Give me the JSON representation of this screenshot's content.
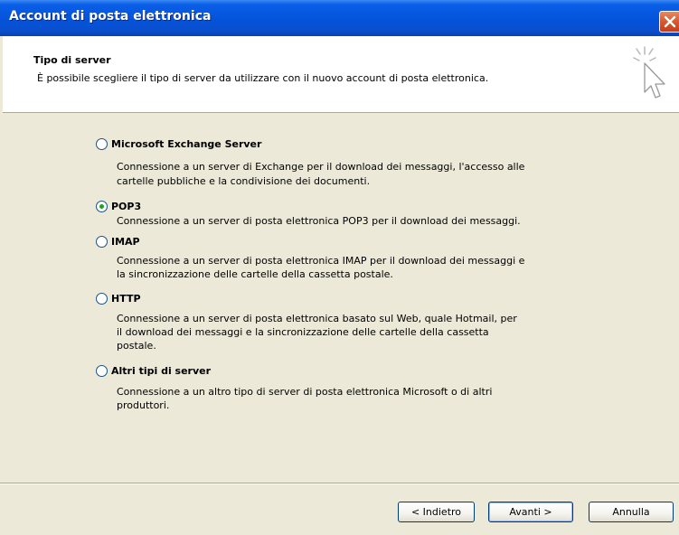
{
  "window": {
    "title": "Account di posta elettronica"
  },
  "header": {
    "title": "Tipo di server",
    "description": "È possibile scegliere il tipo di server da utilizzare con il nuovo account di posta elettronica."
  },
  "options": [
    {
      "label": "Microsoft Exchange Server",
      "selected": false,
      "desc1": "Connessione a un server di Exchange per il download dei messaggi, l'accesso alle",
      "desc2": "cartelle pubbliche e la condivisione dei documenti."
    },
    {
      "label": "POP3",
      "selected": true,
      "desc1": "Connessione a un server di posta elettronica POP3 per il download dei messaggi."
    },
    {
      "label": "IMAP",
      "selected": false,
      "desc1": "Connessione a un server di posta elettronica IMAP per il download dei messaggi e",
      "desc2": "la sincronizzazione delle cartelle della cassetta postale."
    },
    {
      "label": "HTTP",
      "selected": false,
      "desc1": "Connessione a un server di posta elettronica basato sul Web, quale Hotmail, per",
      "desc2": "il download dei messaggi e la sincronizzazione delle cartelle della cassetta",
      "desc3": "postale."
    },
    {
      "label": "Altri tipi di server",
      "selected": false,
      "desc1": "Connessione a un altro tipo di server di posta elettronica Microsoft o di altri",
      "desc2": "produttori."
    }
  ],
  "buttons": {
    "back": "< Indietro",
    "next": "Avanti >",
    "cancel": "Annulla"
  },
  "icons": {
    "close": "close-icon",
    "wizard": "wizard-cursor-icon"
  }
}
